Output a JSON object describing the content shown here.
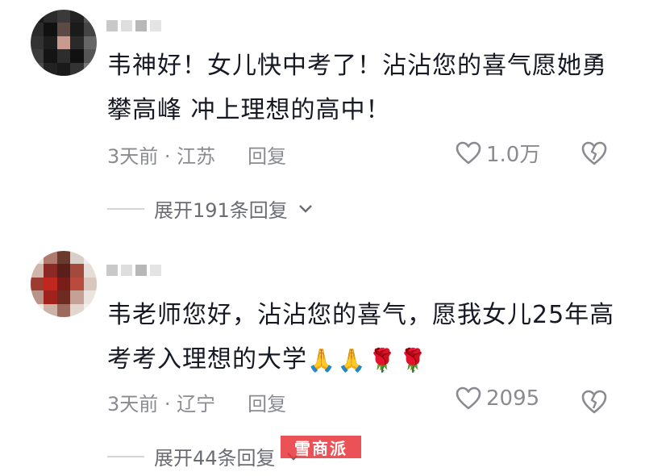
{
  "comments": [
    {
      "text": "韦神好！女儿快中考了！沾沾您的喜气愿她勇攀高峰 冲上理想的高中！",
      "time_location": "3天前 · 江苏",
      "reply_label": "回复",
      "likes": "1.0万",
      "expand_label": "展开191条回复"
    },
    {
      "text": "韦老师您好，沾沾您的喜气，愿我女儿25年高考考入理想的大学",
      "emojis": [
        "🙏",
        "🙏",
        "🌹",
        "🌹"
      ],
      "time_location": "3天前 · 辽宁",
      "reply_label": "回复",
      "likes": "2095",
      "expand_label": "展开44条回复"
    }
  ],
  "watermark": "雪商派",
  "colors": {
    "text": "#161823",
    "meta": "#8a8b91",
    "watermark_bg": "#e8343a"
  },
  "icons": {
    "like": "heart-outline-icon",
    "dislike": "broken-heart-icon",
    "expand": "chevron-down-icon"
  }
}
